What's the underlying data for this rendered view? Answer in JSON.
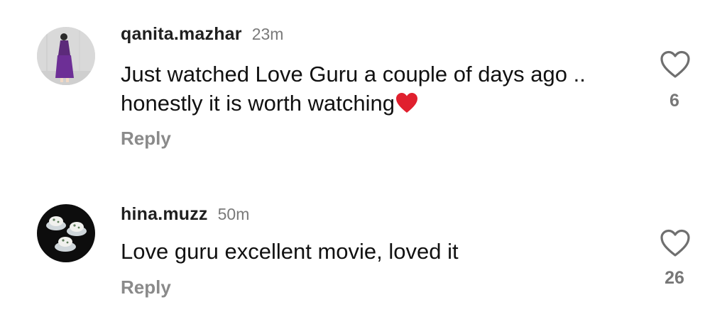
{
  "comments": [
    {
      "username": "qanita.mazhar",
      "time": "23m",
      "text": "Just watched Love Guru a couple of days ago .. honestly it is worth watching",
      "emoji": "red-heart-emoji",
      "reply_label": "Reply",
      "like_count": "6",
      "like_icon": "heart-outline-icon"
    },
    {
      "username": "hina.muzz",
      "time": "50m",
      "text": "Love guru excellent movie, loved it",
      "reply_label": "Reply",
      "like_count": "26",
      "like_icon": "heart-outline-icon"
    }
  ],
  "colors": {
    "username": "#1f1f1f",
    "timestamp": "#7a7a7a",
    "reply": "#8a8a8a",
    "like_count": "#777777",
    "emoji_heart": "#e0202e"
  }
}
